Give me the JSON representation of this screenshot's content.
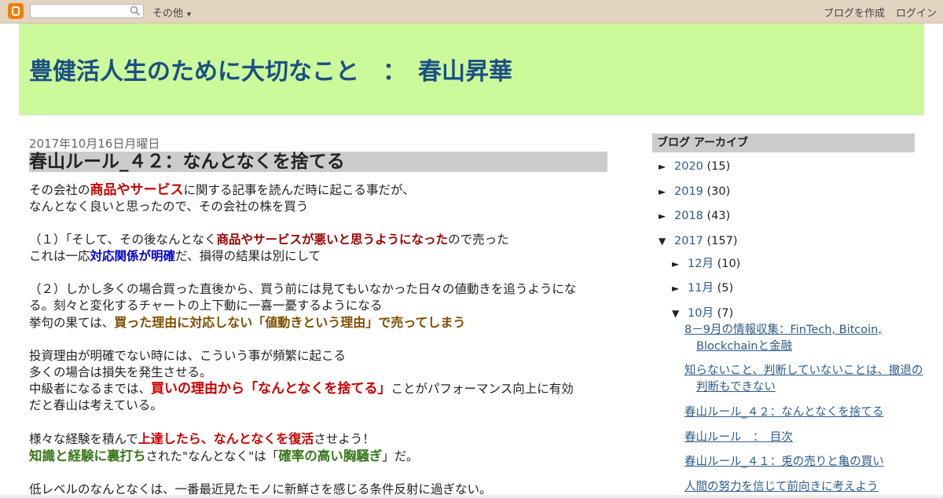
{
  "navbar": {
    "logo_icon": "blogger-logo-icon",
    "search_placeholder": "",
    "more_label": "その他",
    "create_blog_label": "ブログを作成",
    "login_label": "ログイン"
  },
  "blog": {
    "title": "豊健活人生のために大切なこと　：　春山昇華",
    "header_color": "#ccf99a"
  },
  "post": {
    "date": "2017年10月16日月曜日",
    "title": "春山ルール_４２：なんとなくを捨てる",
    "p1": {
      "a": "その会社の",
      "b": "商品やサービス",
      "c": "に関する記事を読んだ時に起こる事だが、",
      "d": "なんとなく良いと思ったので、その会社の株を買う"
    },
    "p2": {
      "a": "（１）「そして、その後なんとなく",
      "b": "商品やサービスが悪いと思うようになった",
      "c": "ので売った",
      "d": "これは一応",
      "e": "対応関係が明確",
      "f": "だ、損得の結果は別にして"
    },
    "p3": {
      "a": "（２）しかし多くの場合買った直後から、買う前には見てもいなかった日々の値動きを追うようにな",
      "b": "る。刻々と変化するチャートの上下動に一喜一憂するようになる",
      "c": "挙句の果ては、",
      "d": "買った理由に対応しない「値動きという理由」で売ってしまう"
    },
    "p4": {
      "a": "投資理由が明確でない時には、こういう事が頻繁に起こる",
      "b": "多くの場合は損失を発生させる。",
      "c": "中級者になるまでは、",
      "d": "買いの理由から「なんとなくを捨てる」",
      "e": "ことがパフォーマンス向上に有効",
      "f": "だと春山は考えている。"
    },
    "p5": {
      "a": "様々な経験を積んで",
      "b": "上達したら、なんとなくを復活",
      "c": "させよう！",
      "d": "知識と経験に裏打ち",
      "e": "された\"なんとなく\"は「",
      "f": "確率の高い胸騒ぎ",
      "g": "」だ。"
    },
    "p6": "低レベルのなんとなくは、一番最近見たモノに新鮮さを感じる条件反射に過ぎない。"
  },
  "sidebar": {
    "archive_title": "ブログ アーカイブ",
    "years": [
      {
        "toggle": "►",
        "year": "2020",
        "count": "(15)"
      },
      {
        "toggle": "►",
        "year": "2019",
        "count": "(30)"
      },
      {
        "toggle": "►",
        "year": "2018",
        "count": "(43)"
      },
      {
        "toggle": "▼",
        "year": "2017",
        "count": "(157)"
      }
    ],
    "months": [
      {
        "toggle": "►",
        "month": "12月",
        "count": "(10)"
      },
      {
        "toggle": "►",
        "month": "11月",
        "count": "(5)"
      },
      {
        "toggle": "▼",
        "month": "10月",
        "count": "(7)"
      }
    ],
    "posts": [
      "8－9月の情報収集：FinTech, Bitcoin, Blockchainと金融",
      "知らないこと、判断していないことは、撤退の判断もできない",
      "春山ルール_４２：なんとなくを捨てる",
      "春山ルール　：　目次",
      "春山ルール_４１：兎の売りと亀の買い",
      "人間の努力を信じて前向きに考えよう"
    ]
  }
}
